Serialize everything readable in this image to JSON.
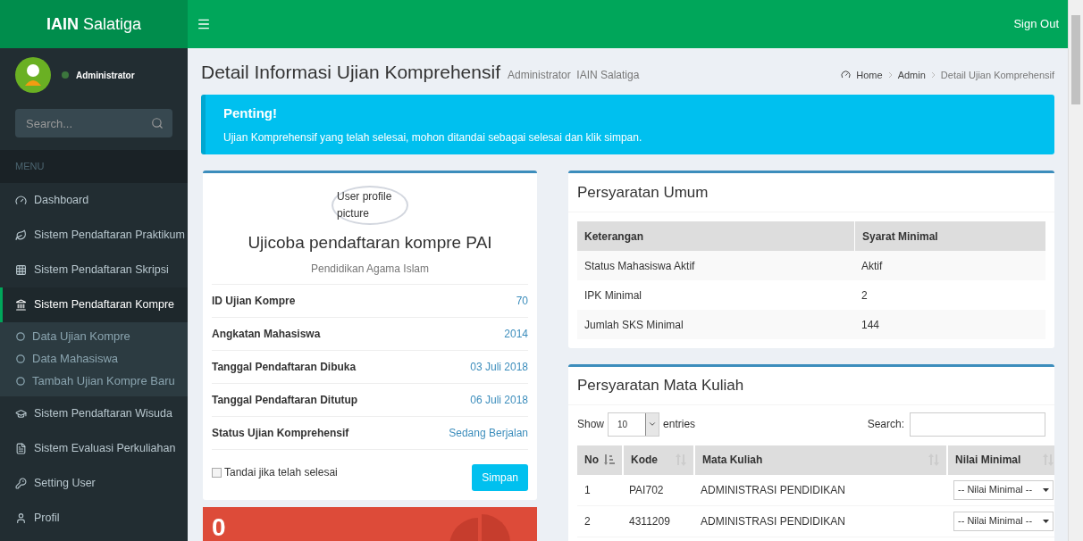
{
  "brand": {
    "bold": "IAIN",
    "rest": "Salatiga"
  },
  "header": {
    "sign_out": "Sign Out"
  },
  "user": {
    "name": "Administrator",
    "online": true
  },
  "sidebar": {
    "search_placeholder": "Search...",
    "menu_header": "MENU",
    "items": [
      {
        "label": "Dashboard",
        "selected": false
      },
      {
        "label": "Sistem Pendaftaran Praktikum",
        "selected": false
      },
      {
        "label": "Sistem Pendaftaran Skripsi",
        "selected": false
      },
      {
        "label": "Sistem Pendaftaran Kompre",
        "selected": true,
        "expanded": true,
        "children": [
          {
            "label": "Data Ujian Kompre",
            "selected": false
          },
          {
            "label": "Data Mahasiswa",
            "selected": false
          },
          {
            "label": "Tambah Ujian Kompre Baru",
            "selected": false
          }
        ]
      },
      {
        "label": "Sistem Pendaftaran Wisuda",
        "selected": false
      },
      {
        "label": "Sistem Evaluasi Perkuliahan",
        "selected": false
      },
      {
        "label": "Setting User",
        "selected": false
      },
      {
        "label": "Profil",
        "selected": false
      }
    ]
  },
  "page": {
    "title": "Detail Informasi Ujian Komprehensif",
    "subtitle": "Administrator  IAIN Salatiga"
  },
  "breadcrumb": [
    {
      "label": "Home"
    },
    {
      "label": "Admin"
    },
    {
      "label": "Detail Ujian Komprehensif"
    }
  ],
  "alert": {
    "title": "Penting!",
    "message": "Ujian Komprehensif yang telah selesai, mohon ditandai sebagai selesai dan klik simpan."
  },
  "profile_card": {
    "picture_alt": "User profile picture",
    "title": "Ujicoba pendaftaran kompre PAI",
    "subtitle": "Pendidikan Agama Islam",
    "rows": [
      {
        "label": "ID Ujian Kompre",
        "value": "70"
      },
      {
        "label": "Angkatan Mahasiswa",
        "value": "2014"
      },
      {
        "label": "Tanggal Pendaftaran Dibuka",
        "value": "03 Juli 2018"
      },
      {
        "label": "Tanggal Pendaftaran Ditutup",
        "value": "06 Juli 2018"
      },
      {
        "label": "Status Ujian Komprehensif",
        "value": "Sedang Berjalan"
      }
    ],
    "checkbox": {
      "label": "Tandai jika telah selesai",
      "checked": false
    },
    "button": "Simpan"
  },
  "stat_box": {
    "value": "0"
  },
  "general_requirements": {
    "title": "Persyaratan Umum",
    "columns": [
      "Keterangan",
      "Syarat Minimal"
    ],
    "rows": [
      [
        "Status Mahasiswa Aktif",
        "Aktif"
      ],
      [
        "IPK Minimal",
        "2"
      ],
      [
        "Jumlah SKS Minimal",
        "144"
      ]
    ]
  },
  "course_requirements": {
    "title": "Persyaratan Mata Kuliah",
    "show_label": "Show",
    "page_size": "10",
    "entries_label": "entries",
    "search_label": "Search:",
    "columns": [
      {
        "label": "No",
        "sorted": true
      },
      {
        "label": "Kode",
        "sorted": false
      },
      {
        "label": "Mata Kuliah",
        "sorted": false
      },
      {
        "label": "Nilai Minimal",
        "sorted": false
      }
    ],
    "rows": [
      {
        "no": "1",
        "kode": "PAI702",
        "mata_kuliah": "ADMINISTRASI PENDIDIKAN",
        "nilai_placeholder": "-- Nilai Minimal --"
      },
      {
        "no": "2",
        "kode": "4311209",
        "mata_kuliah": "ADMINISTRASI PENDIDIKAN",
        "nilai_placeholder": "-- Nilai Minimal --"
      }
    ]
  }
}
